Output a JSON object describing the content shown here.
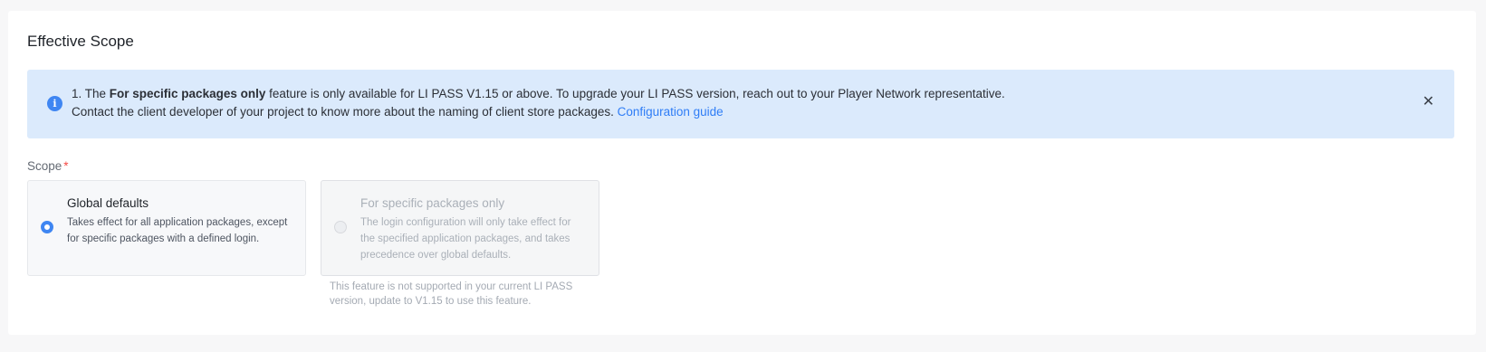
{
  "section": {
    "title": "Effective Scope"
  },
  "alert": {
    "icon": "info-icon",
    "line1_prefix": "1. The ",
    "line1_bold": "For specific packages only",
    "line1_suffix": " feature is only available for LI PASS V1.15 or above. To upgrade your LI PASS version, reach out to your Player Network representative.",
    "line2_text": "Contact the client developer of your project to know more about the naming of client store packages. ",
    "link_label": "Configuration guide",
    "close_symbol": "✕",
    "background_color": "#dbeafc",
    "accent_color": "#3f86f2"
  },
  "scope": {
    "label": "Scope",
    "required_mark": "*",
    "options": [
      {
        "title": "Global defaults",
        "description": "Takes effect for all application packages, except for specific packages with a defined login.",
        "selected": true,
        "disabled": false
      },
      {
        "title": "For specific packages only",
        "description": "The login configuration will only take effect for the specified application packages, and takes precedence over global defaults.",
        "selected": false,
        "disabled": true
      }
    ],
    "unsupported_note": "This feature is not supported in your current LI PASS version, update to V1.15 to use this feature."
  }
}
